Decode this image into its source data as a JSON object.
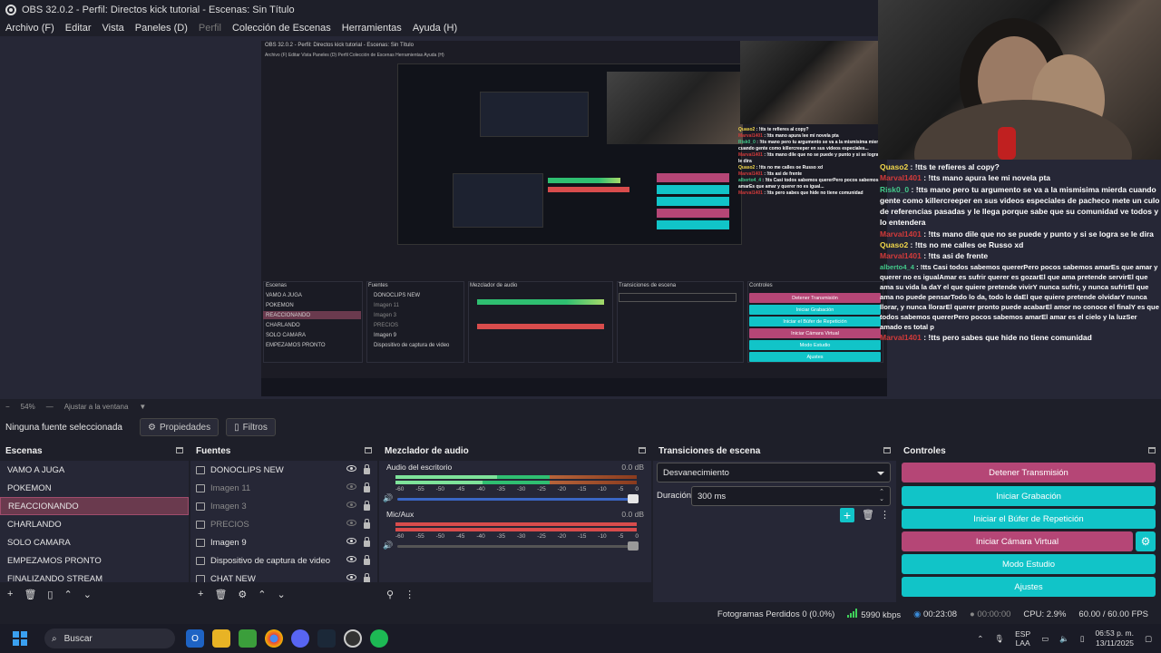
{
  "window": {
    "title": "OBS 32.0.2 - Perfil: Directos kick tutorial - Escenas: Sin Título"
  },
  "menu": [
    "Archivo (F)",
    "Editar",
    "Vista",
    "Paneles (D)",
    "Perfil",
    "Colección de Escenas",
    "Herramientas",
    "Ayuda (H)"
  ],
  "zoom": {
    "value": "54%",
    "fit_label": "Ajustar a la ventana"
  },
  "source_bar": {
    "no_source": "Ninguna fuente seleccionada",
    "properties": "Propiedades",
    "filters": "Filtros"
  },
  "scenes": {
    "title": "Escenas",
    "items": [
      "VAMO A JUGA",
      "POKEMON",
      "REACCIONANDO",
      "CHARLANDO",
      "SOLO CAMARA",
      "EMPEZAMOS PRONTO",
      "FINALIZANDO STREAM"
    ],
    "selected_index": 2
  },
  "sources": {
    "title": "Fuentes",
    "items": [
      {
        "name": "DONOCLIPS NEW",
        "visible": true
      },
      {
        "name": "Imagen 11",
        "visible": false
      },
      {
        "name": "Imagen 3",
        "visible": false
      },
      {
        "name": "PRECIOS",
        "visible": false
      },
      {
        "name": "Imagen 9",
        "visible": true
      },
      {
        "name": "Dispositivo de captura de video",
        "visible": true
      },
      {
        "name": "CHAT NEW",
        "visible": true
      }
    ]
  },
  "mixer": {
    "title": "Mezclador de audio",
    "channels": [
      {
        "name": "Audio del escritorio",
        "db": "0.0 dB",
        "level": 0.42
      },
      {
        "name": "Mic/Aux",
        "db": "0.0 dB",
        "level": 0.0
      }
    ],
    "scale": [
      "-60",
      "-55",
      "-50",
      "-45",
      "-40",
      "-35",
      "-30",
      "-25",
      "-20",
      "-15",
      "-10",
      "-5",
      "0"
    ]
  },
  "transitions": {
    "title": "Transiciones de escena",
    "selected": "Desvanecimiento",
    "duration_label": "Duración",
    "duration_value": "300 ms"
  },
  "controls": {
    "title": "Controles",
    "buttons": [
      "Detener Transmisión",
      "Iniciar Grabación",
      "Iniciar el Búfer de Repetición",
      "Iniciar Cámara Virtual",
      "Modo Estudio",
      "Ajustes"
    ]
  },
  "status": {
    "dropped_frames": "Fotogramas Perdidos 0 (0.0%)",
    "bitrate": "5990 kbps",
    "stream_time": "00:23:08",
    "record_time": "00:00:00",
    "cpu": "CPU: 2.9%",
    "fps": "60.00 / 60.00 FPS"
  },
  "chat": [
    {
      "user": "Quaso2",
      "color": "yellow",
      "text": "!tts te refieres al copy?"
    },
    {
      "user": "Marval1401",
      "color": "red",
      "text": "!tts mano apura lee mi novela pta"
    },
    {
      "user": "Risk0_0",
      "color": "green",
      "text": "!tts mano pero tu argumento se va a la mismisima mierda cuando gente como killercreeper en sus videos especiales de pacheco mete un culo de referencias pasadas y le llega porque sabe que su comunidad ve todos y lo entendera"
    },
    {
      "user": "Marval1401",
      "color": "red",
      "text": "!tts mano dile que no se puede y punto y si se logra se le dira"
    },
    {
      "user": "Quaso2",
      "color": "yellow",
      "text": "!tts no me calles oe Russo xd"
    },
    {
      "user": "Marval1401",
      "color": "red",
      "text": "!tts asi de frente"
    },
    {
      "user": "alberto4_4",
      "color": "green",
      "text": "!tts Casi todos sabemos quererPero pocos sabemos amarEs que amar y querer no es igualAmar es sufrir querer es gozarEl que ama pretende servirEl que ama su vida la daY el que quiere pretende vivirY nunca sufrir, y nunca sufrirEl que ama no puede pensarTodo lo da, todo lo daEl que quiere pretende olvidarY nunca llorar, y nunca llorarEl querer pronto puede acabarEl amor no conoce el finalY es que todos sabemos quererPero pocos sabemos amarEl amar es el cielo y la luzSer amado es total p"
    },
    {
      "user": "Marval1401",
      "color": "red",
      "text": "!tts pero sabes que hide no tiene comunidad"
    }
  ],
  "taskbar": {
    "search": "Buscar",
    "lang": "ESP",
    "lang2": "LAA",
    "time": "06:53 p. m.",
    "date": "13/11/2025"
  },
  "colors": {
    "accent_cyan": "#11c4c8",
    "accent_pink": "#b54676",
    "background": "#1e1f29",
    "panel": "#262736"
  }
}
